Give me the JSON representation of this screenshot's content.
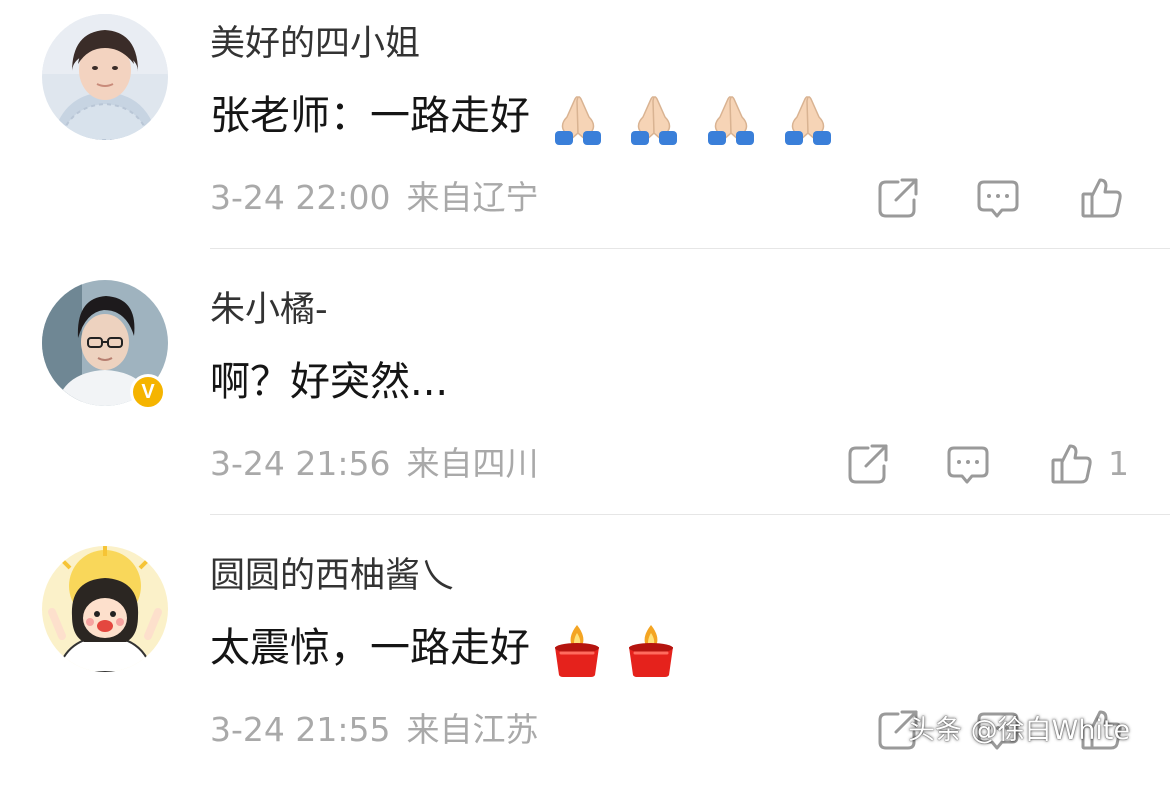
{
  "comments": [
    {
      "username": "美好的四小姐",
      "text": "张老师：一路走好",
      "emoji": "folded-hands",
      "emoji_count": 4,
      "date": "3-24 22:00",
      "location": "来自辽宁",
      "likes": "",
      "verified": false
    },
    {
      "username": "朱小橘-",
      "text": "啊？好突然...",
      "emoji": "",
      "emoji_count": 0,
      "date": "3-24 21:56",
      "location": "来自四川",
      "likes": "1",
      "verified": true,
      "badge": "V"
    },
    {
      "username": "圆圆的西柚酱乀",
      "text": "太震惊，一路走好",
      "emoji": "candle",
      "emoji_count": 2,
      "date": "3-24 21:55",
      "location": "来自江苏",
      "likes": "",
      "verified": false
    }
  ],
  "actions": [
    "share-icon",
    "reply-icon",
    "like-icon"
  ],
  "watermark": "头条 @徐白White",
  "colors": {
    "username": "#333333",
    "text": "#151515",
    "meta": "#a9a9a9",
    "icon": "#9a9a9a",
    "divider": "#e6e6e6",
    "verified_badge": "#f5b400"
  }
}
